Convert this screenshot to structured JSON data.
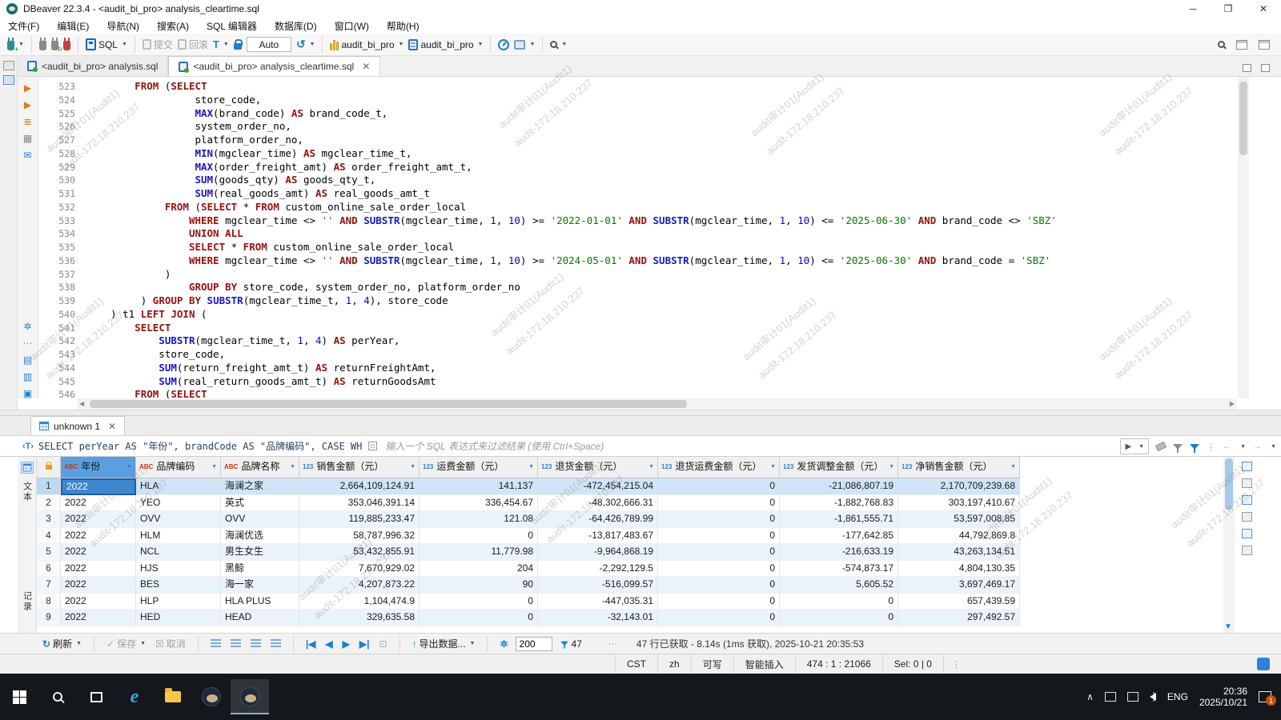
{
  "window": {
    "title": "DBeaver 22.3.4 - <audit_bi_pro> analysis_cleartime.sql"
  },
  "menu": [
    "文件(F)",
    "编辑(E)",
    "导航(N)",
    "搜索(A)",
    "SQL 编辑器",
    "数据库(D)",
    "窗口(W)",
    "帮助(H)"
  ],
  "toolbar": {
    "sql": "SQL",
    "commit": "提交",
    "rollback": "回滚",
    "tx_mode": "Auto",
    "connection": "audit_bi_pro",
    "schema": "audit_bi_pro"
  },
  "editor_tabs": [
    {
      "label": "<audit_bi_pro> analysis.sql"
    },
    {
      "label": "<audit_bi_pro> analysis_cleartime.sql"
    }
  ],
  "watermark": {
    "line1": "audit审计01(Audit1)",
    "line2": "audit-172.18.210.237"
  },
  "editor": {
    "lines": [
      {
        "no": "523",
        "toks": [
          [
            "p",
            "        "
          ],
          [
            "k",
            "FROM"
          ],
          [
            "p",
            " ("
          ],
          [
            "k",
            "SELECT"
          ]
        ]
      },
      {
        "no": "524",
        "toks": [
          [
            "p",
            "                  store_code,"
          ]
        ]
      },
      {
        "no": "525",
        "toks": [
          [
            "p",
            "                  "
          ],
          [
            "f",
            "MAX"
          ],
          [
            "p",
            "(brand_code) "
          ],
          [
            "k",
            "AS"
          ],
          [
            "p",
            " brand_code_t,"
          ]
        ]
      },
      {
        "no": "526",
        "toks": [
          [
            "p",
            "                  system_order_no,"
          ]
        ]
      },
      {
        "no": "527",
        "toks": [
          [
            "p",
            "                  platform_order_no,"
          ]
        ]
      },
      {
        "no": "528",
        "toks": [
          [
            "p",
            "                  "
          ],
          [
            "f",
            "MIN"
          ],
          [
            "p",
            "(mgclear_time) "
          ],
          [
            "k",
            "AS"
          ],
          [
            "p",
            " mgclear_time_t,"
          ]
        ]
      },
      {
        "no": "529",
        "toks": [
          [
            "p",
            "                  "
          ],
          [
            "f",
            "MAX"
          ],
          [
            "p",
            "(order_freight_amt) "
          ],
          [
            "k",
            "AS"
          ],
          [
            "p",
            " order_freight_amt_t,"
          ]
        ]
      },
      {
        "no": "530",
        "toks": [
          [
            "p",
            "                  "
          ],
          [
            "f",
            "SUM"
          ],
          [
            "p",
            "(goods_qty) "
          ],
          [
            "k",
            "AS"
          ],
          [
            "p",
            " goods_qty_t,"
          ]
        ]
      },
      {
        "no": "531",
        "toks": [
          [
            "p",
            "                  "
          ],
          [
            "f",
            "SUM"
          ],
          [
            "p",
            "(real_goods_amt) "
          ],
          [
            "k",
            "AS"
          ],
          [
            "p",
            " real_goods_amt_t"
          ]
        ]
      },
      {
        "no": "532",
        "toks": [
          [
            "p",
            "             "
          ],
          [
            "k",
            "FROM"
          ],
          [
            "p",
            " ("
          ],
          [
            "k",
            "SELECT"
          ],
          [
            "p",
            " * "
          ],
          [
            "k",
            "FROM"
          ],
          [
            "p",
            " custom_online_sale_order_local"
          ]
        ]
      },
      {
        "no": "533",
        "toks": [
          [
            "p",
            "                 "
          ],
          [
            "k",
            "WHERE"
          ],
          [
            "p",
            " mgclear_time <> "
          ],
          [
            "s",
            "''"
          ],
          [
            "p",
            " "
          ],
          [
            "k",
            "AND"
          ],
          [
            "p",
            " "
          ],
          [
            "f",
            "SUBSTR"
          ],
          [
            "p",
            "(mgclear_time, "
          ],
          [
            "n",
            "1"
          ],
          [
            "p",
            ", "
          ],
          [
            "n",
            "10"
          ],
          [
            "p",
            ") >= "
          ],
          [
            "s",
            "'2022-01-01'"
          ],
          [
            "p",
            " "
          ],
          [
            "k",
            "AND"
          ],
          [
            "p",
            " "
          ],
          [
            "f",
            "SUBSTR"
          ],
          [
            "p",
            "(mgclear_time, "
          ],
          [
            "n",
            "1"
          ],
          [
            "p",
            ", "
          ],
          [
            "n",
            "10"
          ],
          [
            "p",
            ") <= "
          ],
          [
            "s",
            "'2025-06-30'"
          ],
          [
            "p",
            " "
          ],
          [
            "k",
            "AND"
          ],
          [
            "p",
            " brand_code <> "
          ],
          [
            "s",
            "'SBZ'"
          ]
        ]
      },
      {
        "no": "534",
        "toks": [
          [
            "p",
            "                 "
          ],
          [
            "k",
            "UNION ALL"
          ]
        ]
      },
      {
        "no": "535",
        "toks": [
          [
            "p",
            "                 "
          ],
          [
            "k",
            "SELECT"
          ],
          [
            "p",
            " * "
          ],
          [
            "k",
            "FROM"
          ],
          [
            "p",
            " custom_online_sale_order_local"
          ]
        ]
      },
      {
        "no": "536",
        "toks": [
          [
            "p",
            "                 "
          ],
          [
            "k",
            "WHERE"
          ],
          [
            "p",
            " mgclear_time <> "
          ],
          [
            "s",
            "''"
          ],
          [
            "p",
            " "
          ],
          [
            "k",
            "AND"
          ],
          [
            "p",
            " "
          ],
          [
            "f",
            "SUBSTR"
          ],
          [
            "p",
            "(mgclear_time, "
          ],
          [
            "n",
            "1"
          ],
          [
            "p",
            ", "
          ],
          [
            "n",
            "10"
          ],
          [
            "p",
            ") >= "
          ],
          [
            "s",
            "'2024-05-01'"
          ],
          [
            "p",
            " "
          ],
          [
            "k",
            "AND"
          ],
          [
            "p",
            " "
          ],
          [
            "f",
            "SUBSTR"
          ],
          [
            "p",
            "(mgclear_time, "
          ],
          [
            "n",
            "1"
          ],
          [
            "p",
            ", "
          ],
          [
            "n",
            "10"
          ],
          [
            "p",
            ") <= "
          ],
          [
            "s",
            "'2025-06-30'"
          ],
          [
            "p",
            " "
          ],
          [
            "k",
            "AND"
          ],
          [
            "p",
            " brand_code = "
          ],
          [
            "s",
            "'SBZ'"
          ]
        ]
      },
      {
        "no": "537",
        "toks": [
          [
            "p",
            "             )"
          ]
        ]
      },
      {
        "no": "538",
        "toks": [
          [
            "p",
            "                 "
          ],
          [
            "k",
            "GROUP BY"
          ],
          [
            "p",
            " store_code, system_order_no, platform_order_no"
          ]
        ]
      },
      {
        "no": "539",
        "toks": [
          [
            "p",
            "         ) "
          ],
          [
            "k",
            "GROUP BY"
          ],
          [
            "p",
            " "
          ],
          [
            "f",
            "SUBSTR"
          ],
          [
            "p",
            "(mgclear_time_t, "
          ],
          [
            "n",
            "1"
          ],
          [
            "p",
            ", "
          ],
          [
            "n",
            "4"
          ],
          [
            "p",
            "), store_code"
          ]
        ]
      },
      {
        "no": "540",
        "toks": [
          [
            "p",
            "    ) t1 "
          ],
          [
            "k",
            "LEFT JOIN"
          ],
          [
            "p",
            " ("
          ]
        ]
      },
      {
        "no": "541",
        "toks": [
          [
            "p",
            "        "
          ],
          [
            "k",
            "SELECT"
          ]
        ]
      },
      {
        "no": "542",
        "toks": [
          [
            "p",
            "            "
          ],
          [
            "f",
            "SUBSTR"
          ],
          [
            "p",
            "(mgclear_time_t, "
          ],
          [
            "n",
            "1"
          ],
          [
            "p",
            ", "
          ],
          [
            "n",
            "4"
          ],
          [
            "p",
            ") "
          ],
          [
            "k",
            "AS"
          ],
          [
            "p",
            " perYear,"
          ]
        ]
      },
      {
        "no": "543",
        "toks": [
          [
            "p",
            "            store_code,"
          ]
        ]
      },
      {
        "no": "544",
        "toks": [
          [
            "p",
            "            "
          ],
          [
            "f",
            "SUM"
          ],
          [
            "p",
            "(return_freight_amt_t) "
          ],
          [
            "k",
            "AS"
          ],
          [
            "p",
            " returnFreightAmt,"
          ]
        ]
      },
      {
        "no": "545",
        "toks": [
          [
            "p",
            "            "
          ],
          [
            "f",
            "SUM"
          ],
          [
            "p",
            "(real_return_goods_amt_t) "
          ],
          [
            "k",
            "AS"
          ],
          [
            "p",
            " returnGoodsAmt"
          ]
        ]
      },
      {
        "no": "546",
        "toks": [
          [
            "p",
            "        "
          ],
          [
            "k",
            "FROM"
          ],
          [
            "p",
            " ("
          ],
          [
            "k",
            "SELECT"
          ]
        ]
      }
    ]
  },
  "results": {
    "tab": "unknown 1",
    "filter_query": "SELECT perYear AS \"年份\", brandCode AS \"品牌编码\", CASE WH",
    "filter_placeholder": "输入一个 SQL 表达式来过滤结果 (使用 Ctrl+Space)",
    "presentations": {
      "text": "文本",
      "record": "记录"
    },
    "columns": [
      {
        "badge": "ABC",
        "label": "年份"
      },
      {
        "badge": "ABC",
        "label": "品牌编码"
      },
      {
        "badge": "ABC",
        "label": "品牌名称"
      },
      {
        "badge": "123",
        "label": "销售金额（元）"
      },
      {
        "badge": "123",
        "label": "运费金额（元）"
      },
      {
        "badge": "123",
        "label": "退货金额（元）"
      },
      {
        "badge": "123",
        "label": "退货运费金额（元）"
      },
      {
        "badge": "123",
        "label": "发货调整金额（元）"
      },
      {
        "badge": "123",
        "label": "净销售金额（元）"
      }
    ],
    "rows": [
      [
        "2022",
        "HLA",
        "海澜之家",
        "2,664,109,124.91",
        "141,137",
        "-472,454,215.04",
        "0",
        "-21,086,807.19",
        "2,170,709,239.68"
      ],
      [
        "2022",
        "YEO",
        "英式",
        "353,046,391.14",
        "336,454.67",
        "-48,302,666.31",
        "0",
        "-1,882,768.83",
        "303,197,410.67"
      ],
      [
        "2022",
        "OVV",
        "OVV",
        "119,885,233.47",
        "121.08",
        "-64,426,789.99",
        "0",
        "-1,861,555.71",
        "53,597,008.85"
      ],
      [
        "2022",
        "HLM",
        "海澜优选",
        "58,787,996.32",
        "0",
        "-13,817,483.67",
        "0",
        "-177,642.85",
        "44,792,869.8"
      ],
      [
        "2022",
        "NCL",
        "男生女生",
        "53,432,855.91",
        "11,779.98",
        "-9,964,868.19",
        "0",
        "-216,633.19",
        "43,263,134.51"
      ],
      [
        "2022",
        "HJS",
        "黑鲸",
        "7,670,929.02",
        "204",
        "-2,292,129.5",
        "0",
        "-574,873.17",
        "4,804,130.35"
      ],
      [
        "2022",
        "BES",
        "海一家",
        "4,207,873.22",
        "90",
        "-516,099.57",
        "0",
        "5,605.52",
        "3,697,469.17"
      ],
      [
        "2022",
        "HLP",
        "HLA PLUS",
        "1,104,474.9",
        "0",
        "-447,035.31",
        "0",
        "0",
        "657,439.59"
      ],
      [
        "2022",
        "HED",
        "HEAD",
        "329,635.58",
        "0",
        "-32,143.01",
        "0",
        "0",
        "297,492.57"
      ]
    ],
    "toolbar": {
      "refresh": "刷新",
      "save": "保存",
      "cancel": "取消",
      "export": "导出数据...",
      "fetch_size": "200",
      "filter_count": "47",
      "status": "47 行已获取 - 8.14s (1ms 获取), 2025-10-21 20:35:53"
    }
  },
  "status_bar": {
    "segments": [
      "CST",
      "zh",
      "可写",
      "智能插入",
      "474 : 1 : 21066",
      "Sel: 0 | 0"
    ]
  },
  "taskbar": {
    "lang": "ENG",
    "time": "20:36",
    "date": "2025/10/21",
    "badge": "1"
  }
}
